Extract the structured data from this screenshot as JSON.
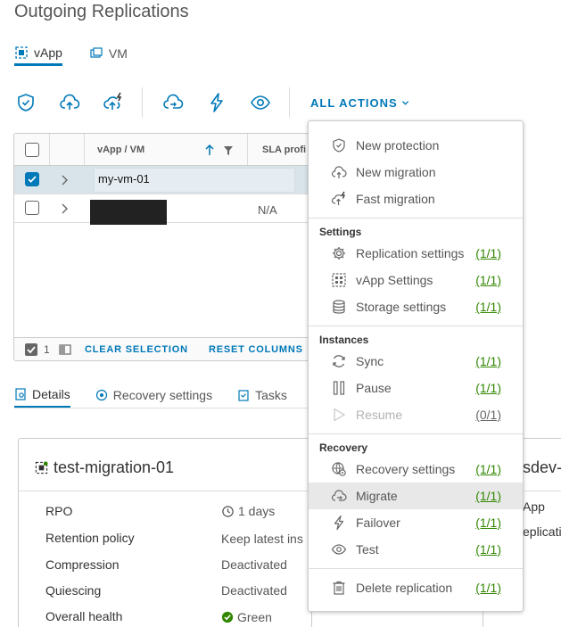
{
  "page": {
    "title": "Outgoing Replications"
  },
  "tabs": [
    {
      "label": "vApp"
    },
    {
      "label": "VM"
    }
  ],
  "toolbar": {
    "all_actions_label": "ALL ACTIONS"
  },
  "grid": {
    "columns": {
      "name": "vApp / VM",
      "sla": "SLA profi"
    },
    "rows": [
      {
        "name": "my-vm-01",
        "sla": "",
        "selected": true
      },
      {
        "name": "",
        "sla": "N/A",
        "selected": false
      }
    ],
    "footer": {
      "selected_count": "1",
      "clear_selection": "CLEAR SELECTION",
      "reset_columns": "RESET COLUMNS"
    }
  },
  "detail_tabs": [
    {
      "label": "Details"
    },
    {
      "label": "Recovery settings"
    },
    {
      "label": "Tasks"
    }
  ],
  "card": {
    "title": "test-migration-01",
    "properties": [
      {
        "label": "RPO",
        "value": "1 days"
      },
      {
        "label": "Retention policy",
        "value": "Keep latest ins"
      },
      {
        "label": "Compression",
        "value": "Deactivated"
      },
      {
        "label": "Quiescing",
        "value": "Deactivated"
      },
      {
        "label": "Overall health",
        "value": "Green"
      }
    ]
  },
  "card2": {
    "title_fragment": "sdev-",
    "line1": "App",
    "line2": "eplicati"
  },
  "menu": {
    "top_items": [
      {
        "label": "New protection"
      },
      {
        "label": "New migration"
      },
      {
        "label": "Fast migration"
      }
    ],
    "settings": {
      "heading": "Settings",
      "items": [
        {
          "label": "Replication settings",
          "count": "(1/1)"
        },
        {
          "label": "vApp Settings",
          "count": "(1/1)"
        },
        {
          "label": "Storage settings",
          "count": "(1/1)"
        }
      ]
    },
    "instances": {
      "heading": "Instances",
      "items": [
        {
          "label": "Sync",
          "count": "(1/1)"
        },
        {
          "label": "Pause",
          "count": "(1/1)"
        },
        {
          "label": "Resume",
          "count": "(0/1)"
        }
      ]
    },
    "recovery": {
      "heading": "Recovery",
      "items": [
        {
          "label": "Recovery settings",
          "count": "(1/1)"
        },
        {
          "label": "Migrate",
          "count": "(1/1)"
        },
        {
          "label": "Failover",
          "count": "(1/1)"
        },
        {
          "label": "Test",
          "count": "(1/1)"
        }
      ]
    },
    "delete": {
      "label": "Delete replication",
      "count": "(1/1)"
    }
  },
  "colors": {
    "accent": "#0079b8",
    "count_green": "#318700",
    "health_green": "#318700"
  }
}
